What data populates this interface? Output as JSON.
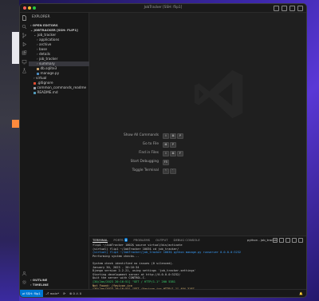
{
  "window": {
    "title": "JobTracker [SSH: flip1]",
    "traffic_lights": [
      "#ff5f57",
      "#febc2e",
      "#28c840"
    ]
  },
  "activity_bar": {
    "icons": [
      "files-icon",
      "search-icon",
      "source-control-icon",
      "run-debug-icon",
      "extensions-icon",
      "remote-explorer-icon",
      "testing-icon"
    ],
    "bottom_icons": [
      "account-icon",
      "settings-gear-icon"
    ]
  },
  "sidebar": {
    "title": "EXPLORER",
    "open_editors": "OPEN EDITORS",
    "folder": "JOBTRACKER [SSH: FLIP1]",
    "items": [
      {
        "label": "job_tracker",
        "indent": 1,
        "type": "folder-open",
        "selected": false,
        "modified": false
      },
      {
        "label": "applications",
        "indent": 2,
        "type": "folder",
        "selected": false,
        "modified": true
      },
      {
        "label": "archive",
        "indent": 2,
        "type": "folder",
        "selected": false,
        "modified": false
      },
      {
        "label": "base",
        "indent": 2,
        "type": "folder",
        "selected": false,
        "modified": false
      },
      {
        "label": "details",
        "indent": 2,
        "type": "folder",
        "selected": false,
        "modified": false
      },
      {
        "label": "job_tracker",
        "indent": 2,
        "type": "folder",
        "selected": false,
        "modified": false
      },
      {
        "label": "summary",
        "indent": 2,
        "type": "folder",
        "selected": true,
        "modified": true
      },
      {
        "label": "db.sqlite3",
        "indent": 2,
        "type": "file-db",
        "selected": false,
        "modified": false
      },
      {
        "label": "manage.py",
        "indent": 2,
        "type": "file-py",
        "selected": false,
        "modified": false
      },
      {
        "label": "virtual",
        "indent": 1,
        "type": "folder",
        "selected": false,
        "modified": false
      },
      {
        "label": ".gitignore",
        "indent": 1,
        "type": "file-git",
        "selected": false,
        "modified": false
      },
      {
        "label": "common_commands_readme",
        "indent": 1,
        "type": "file-text",
        "selected": false,
        "modified": false
      },
      {
        "label": "README.md",
        "indent": 1,
        "type": "file-md",
        "selected": false,
        "modified": false
      }
    ],
    "outline": "OUTLINE",
    "timeline": "TIMELINE"
  },
  "editor": {
    "shortcuts": [
      {
        "label": "Show All Commands",
        "keys": [
          "⇧",
          "⌘",
          "P"
        ]
      },
      {
        "label": "Go to File",
        "keys": [
          "⌘",
          "P"
        ]
      },
      {
        "label": "Find in Files",
        "keys": [
          "⇧",
          "⌘",
          "F"
        ]
      },
      {
        "label": "Start Debugging",
        "keys": [
          "F5"
        ]
      },
      {
        "label": "Toggle Terminal",
        "keys": [
          "⌃",
          "`"
        ]
      }
    ]
  },
  "panel": {
    "tabs": [
      "TERMINAL",
      "PORTS",
      "PROBLEMS",
      "OUTPUT",
      "DEBUG CONSOLE"
    ],
    "ports_badge": "8",
    "terminal_label": "python - job_tracker",
    "lines": [
      {
        "text": "flip1 ~/JobTracker 1002$ source virtual/bin/activate",
        "cls": ""
      },
      {
        "text": "(virtual) flip1 ~/JobTracker 1003$ cd job_tracker/",
        "cls": ""
      },
      {
        "text": "(virtual) flip1 ~/JobTracker/job_tracker 1003$ python manage.py runserver 0.0.0.0:3232",
        "cls": "hl"
      },
      {
        "text": "Performing system checks...",
        "cls": ""
      },
      {
        "text": "",
        "cls": ""
      },
      {
        "text": "System check identified no issues (0 silenced).",
        "cls": ""
      },
      {
        "text": "January 30, 2023 - 20:16:34",
        "cls": ""
      },
      {
        "text": "Django version 2.2.21, using settings 'job_tracker.settings'",
        "cls": ""
      },
      {
        "text": "Starting development server at http://0.0.0.0:3232/",
        "cls": ""
      },
      {
        "text": "Quit the server with CONTROL-C.",
        "cls": ""
      },
      {
        "text": "[30/Jan/2023 20:16:51] \"GET / HTTP/1.1\" 200 5381",
        "cls": "ok"
      },
      {
        "text": "Not Found: /favicon.ico",
        "cls": "warn"
      },
      {
        "text": "[30/Jan/2023 20:16:53] \"GET /favicon.ico HTTP/1.1\" 404 3187",
        "cls": "warn"
      }
    ]
  },
  "statusbar": {
    "remote": "SSH: flip1",
    "branch": "main*",
    "sync": "⟳",
    "errors": "⊗ 0 ⚠ 0",
    "right": "🔔"
  }
}
